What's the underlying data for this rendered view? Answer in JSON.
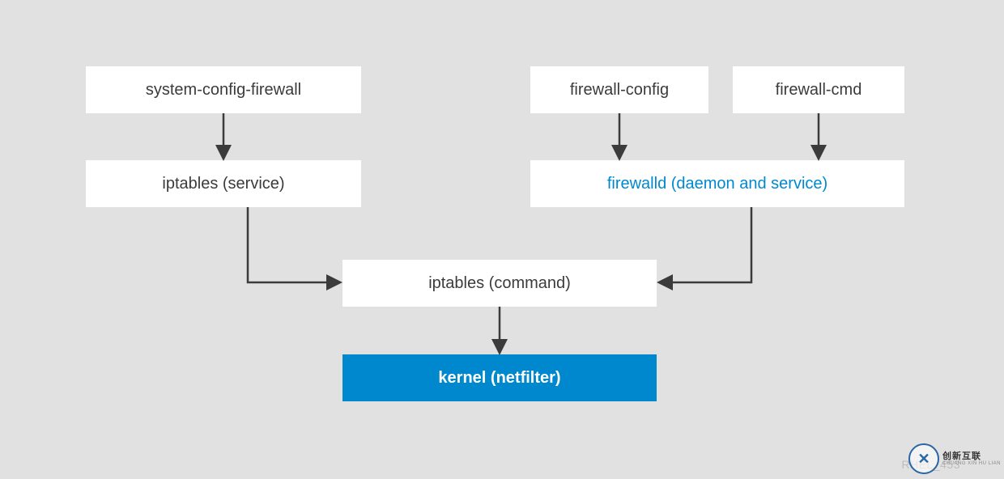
{
  "nodes": {
    "system_config_firewall": "system-config-firewall",
    "firewall_config": "firewall-config",
    "firewall_cmd": "firewall-cmd",
    "iptables_service": "iptables (service)",
    "firewalld_daemon": "firewalld (daemon and service)",
    "iptables_command": "iptables (command)",
    "kernel_netfilter": "kernel (netfilter)"
  },
  "footer_id": "RHEL_453",
  "watermark": {
    "main": "创新互联",
    "sub": "CHUANG XIN HU LIAN",
    "glyph": "✕"
  },
  "colors": {
    "bg": "#e1e1e1",
    "node_bg": "#ffffff",
    "text": "#3b3b3b",
    "accent": "#0088ce",
    "arrow": "#3b3b3b"
  }
}
